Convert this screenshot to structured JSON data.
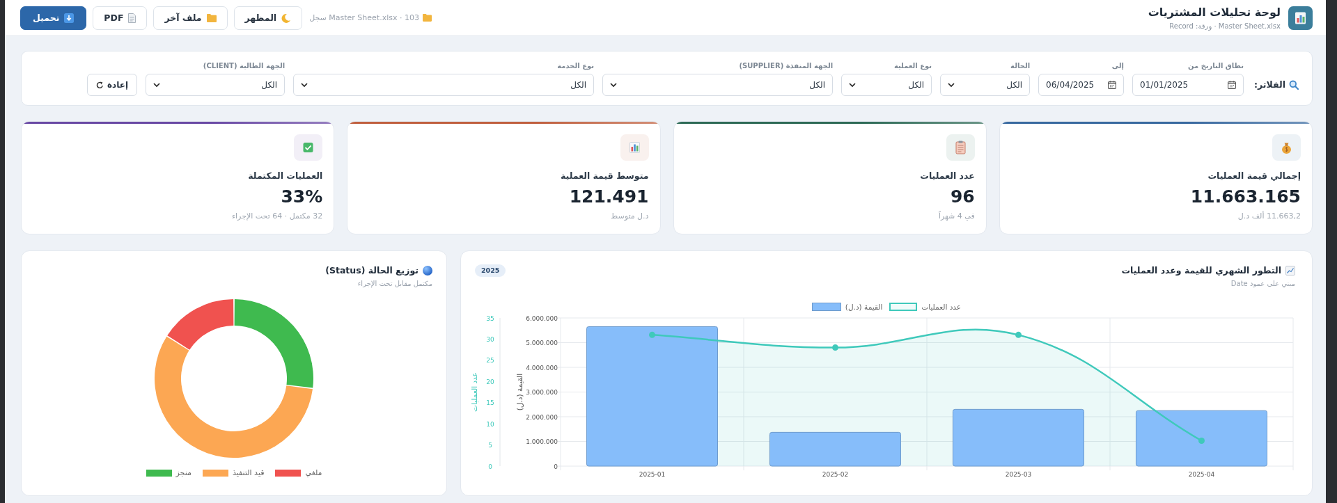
{
  "header": {
    "title": "لوحة تحليلات المشتريات",
    "subtitle": "Master Sheet.xlsx · ورقة: Record",
    "file_info": "Master Sheet.xlsx · 103 سجل",
    "buttons": [
      {
        "kind": "outline",
        "label": "المظهر"
      },
      {
        "kind": "outline",
        "label": "ملف آخر"
      },
      {
        "kind": "outline",
        "label": "PDF"
      },
      {
        "kind": "primary",
        "label": "تحميل"
      }
    ]
  },
  "filters": {
    "title": "الفلاتر:",
    "fields": [
      {
        "kind": "date",
        "label": "نطاق التاريخ من",
        "value": "01/01/2025"
      },
      {
        "kind": "date",
        "label": "إلى",
        "value": "06/04/2025"
      },
      {
        "kind": "select",
        "label": "الحالة",
        "value": "الكل"
      },
      {
        "kind": "select",
        "label": "نوع العملية",
        "value": "الكل"
      },
      {
        "kind": "select",
        "label": "الجهة المنفذة (SUPPLIER)",
        "value": "الكل"
      },
      {
        "kind": "select",
        "label": "نوع الخدمة",
        "value": "الكل"
      },
      {
        "kind": "select",
        "label": "الجهة الطالبة (CLIENT)",
        "value": "الكل"
      }
    ],
    "reset_button": "إعادة"
  },
  "kpis": [
    {
      "label": "إجمالي قيمة العمليات",
      "value": "11.663.165",
      "note": "11.663,2 ألف د.ل",
      "color": "#3a6aa0"
    },
    {
      "label": "عدد العمليات",
      "value": "96",
      "note": "في 4 شهراً",
      "color": "#2e6b57"
    },
    {
      "label": "متوسط قيمة العملية",
      "value": "121.491",
      "note": "د.ل متوسط",
      "color": "#c0603f"
    },
    {
      "label": "العمليات المكتملة",
      "value": "33%",
      "note": "32 مكتمل · 64 تحت الإجراء",
      "color": "#6a4aa5"
    }
  ],
  "charts": [
    {
      "title": "التطور الشهري للقيمة وعدد العمليات",
      "subtitle": "مبني على عمود Date",
      "badge": "2025",
      "chart_data": {
        "type": "bar",
        "categories": [
          "2025-01",
          "2025-02",
          "2025-03",
          "2025-04"
        ],
        "series": [
          {
            "name": "القيمة (د.ل)",
            "color": "#86bdfa",
            "type": "bar",
            "axis": "y2",
            "values": [
              5650000,
              1370000,
              2300000,
              2250000
            ]
          },
          {
            "name": "عدد العمليات",
            "color": "#3fc9bb",
            "type": "area",
            "values": [
              31,
              28,
              31,
              6
            ]
          }
        ],
        "ylabel": "عدد العمليات",
        "ylim": [
          0,
          35
        ],
        "yticks": [
          0,
          5,
          10,
          15,
          20,
          25,
          30,
          35
        ],
        "y2label": "القيمة (د.ل)",
        "y2lim": [
          0,
          6000000
        ],
        "y2ticks": [
          {
            "value": 0,
            "label": "0"
          },
          {
            "value": 1000000,
            "label": "1.000.000"
          },
          {
            "value": 2000000,
            "label": "2.000.000"
          },
          {
            "value": 3000000,
            "label": "3.000.000"
          },
          {
            "value": 4000000,
            "label": "4.000.000"
          },
          {
            "value": 5000000,
            "label": "5.000.000"
          },
          {
            "value": 6000000,
            "label": "6.000.000"
          }
        ],
        "grid": true,
        "legend": "top"
      }
    },
    {
      "title": "توزيع الحالة (Status)",
      "subtitle": "مكتمل مقابل تحت الإجراء",
      "chart_data": {
        "type": "donut",
        "categories": [
          "منجز",
          "قيد التنفيذ",
          "ملغي"
        ],
        "values": [
          27,
          57,
          16
        ],
        "colors": [
          "#3fba4f",
          "#fca753",
          "#f0524f"
        ],
        "legend": "bottom"
      }
    }
  ]
}
